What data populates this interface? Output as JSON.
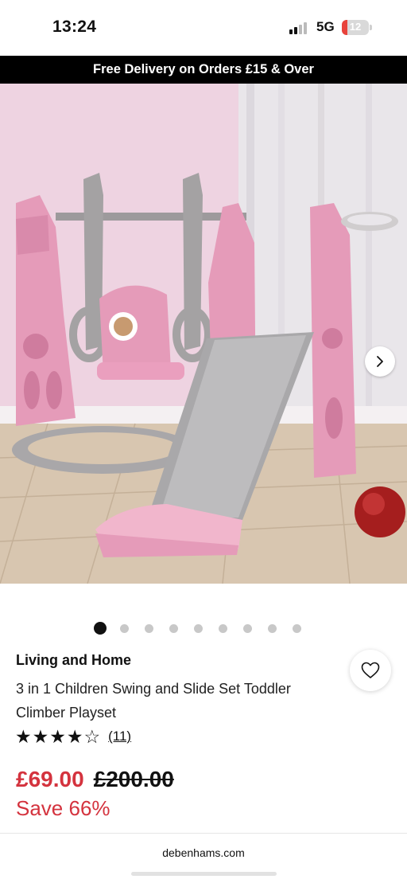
{
  "status_bar": {
    "time": "13:24",
    "network": "5G",
    "battery": "12"
  },
  "promo": {
    "text": "Free Delivery on Orders £15 & Over"
  },
  "gallery": {
    "image_subject": "pink swing and slide playset",
    "next_icon": "chevron-right-icon",
    "zoom_icon": "zoom-in-icon",
    "slide_count": 9,
    "active_slide": 1
  },
  "product": {
    "brand": "Living and Home",
    "title": "3 in 1 Children Swing and Slide Set Toddler Climber Playset",
    "rating_stars": "★★★★☆",
    "rating_value": 4.5,
    "review_count": "(11)",
    "price_now": "£69.00",
    "price_was": "£200.00",
    "save_text": "Save 66%"
  },
  "browser": {
    "url": "debenhams.com"
  },
  "colors": {
    "price_red": "#d4333e",
    "banner_bg": "#000000",
    "accent_pink": "#e8a6c0"
  }
}
